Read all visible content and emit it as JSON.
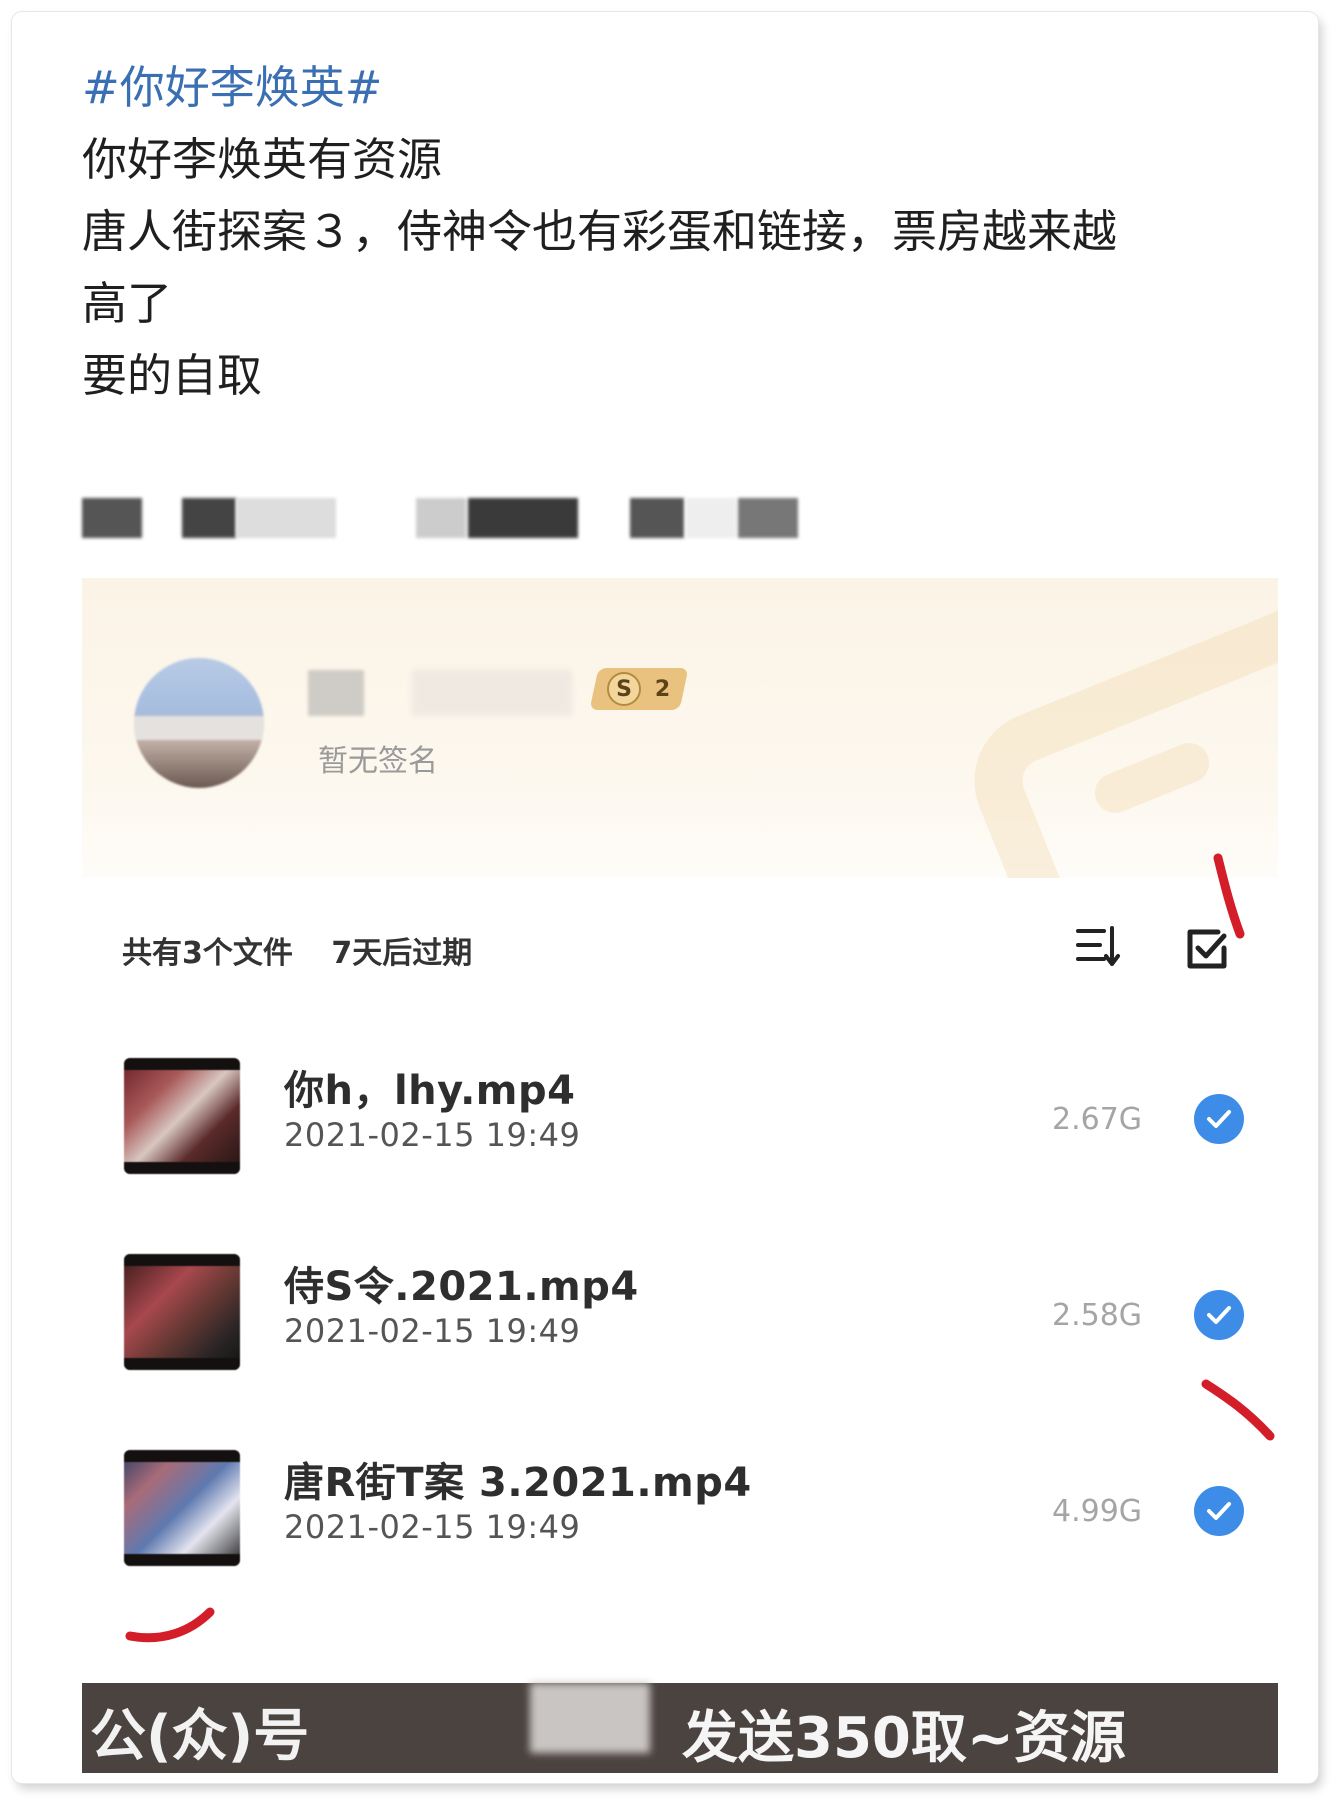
{
  "post": {
    "hashtag": "#你好李焕英#",
    "lines": [
      "你好李焕英有资源",
      "唐人街探案３，侍神令也有彩蛋和链接，票房越来越",
      "高了",
      "要的自取"
    ]
  },
  "card": {
    "user": {
      "badge_letter": "S",
      "badge_level": "2",
      "signature": "暂无签名"
    },
    "meta": {
      "file_count": "共有3个文件",
      "expiry": "7天后过期"
    },
    "icons": {
      "sort": "sort-icon",
      "select": "select-all-icon",
      "check": "check-circle-icon"
    },
    "files": [
      {
        "name": "你h，lhy.mp4",
        "date": "2021-02-15 19:49",
        "size": "2.67G",
        "checked": true
      },
      {
        "name": "侍S令.2021.mp4",
        "date": "2021-02-15 19:49",
        "size": "2.58G",
        "checked": true
      },
      {
        "name": "唐R街T案 3.2021.mp4",
        "date": "2021-02-15 19:49",
        "size": "4.99G",
        "checked": true
      }
    ],
    "banner": {
      "left": "公(众)号",
      "right": "发送350取~资源"
    }
  },
  "colors": {
    "hashtag": "#3b6fb3",
    "check": "#3d8de8",
    "annotation": "#d31e2a",
    "banner_bg": "#4b4340"
  }
}
